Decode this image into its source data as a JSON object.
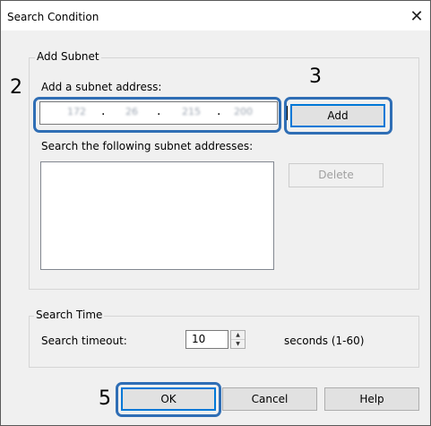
{
  "window": {
    "title": "Search Condition",
    "close_glyph": "✕"
  },
  "add_subnet": {
    "group_label": "Add Subnet",
    "address_label": "Add a subnet address:",
    "ip_segments": [
      "172",
      "26",
      "215",
      "200"
    ],
    "dot": ".",
    "add_button": "Add",
    "list_label": "Search the following subnet addresses:",
    "delete_button": "Delete"
  },
  "search_time": {
    "group_label": "Search Time",
    "timeout_label": "Search timeout:",
    "timeout_value": "10",
    "unit_label": "seconds (1-60)",
    "spin_up_glyph": "▲",
    "spin_down_glyph": "▼"
  },
  "footer": {
    "ok_button": "OK",
    "cancel_button": "Cancel",
    "help_button": "Help"
  },
  "annotations": {
    "step_ip": "2",
    "step_add": "3",
    "step_ok": "5"
  },
  "colors": {
    "callout": "#2f6eb5",
    "default_button_border": "#0078d7",
    "disabled_text": "#a0a0a0"
  }
}
